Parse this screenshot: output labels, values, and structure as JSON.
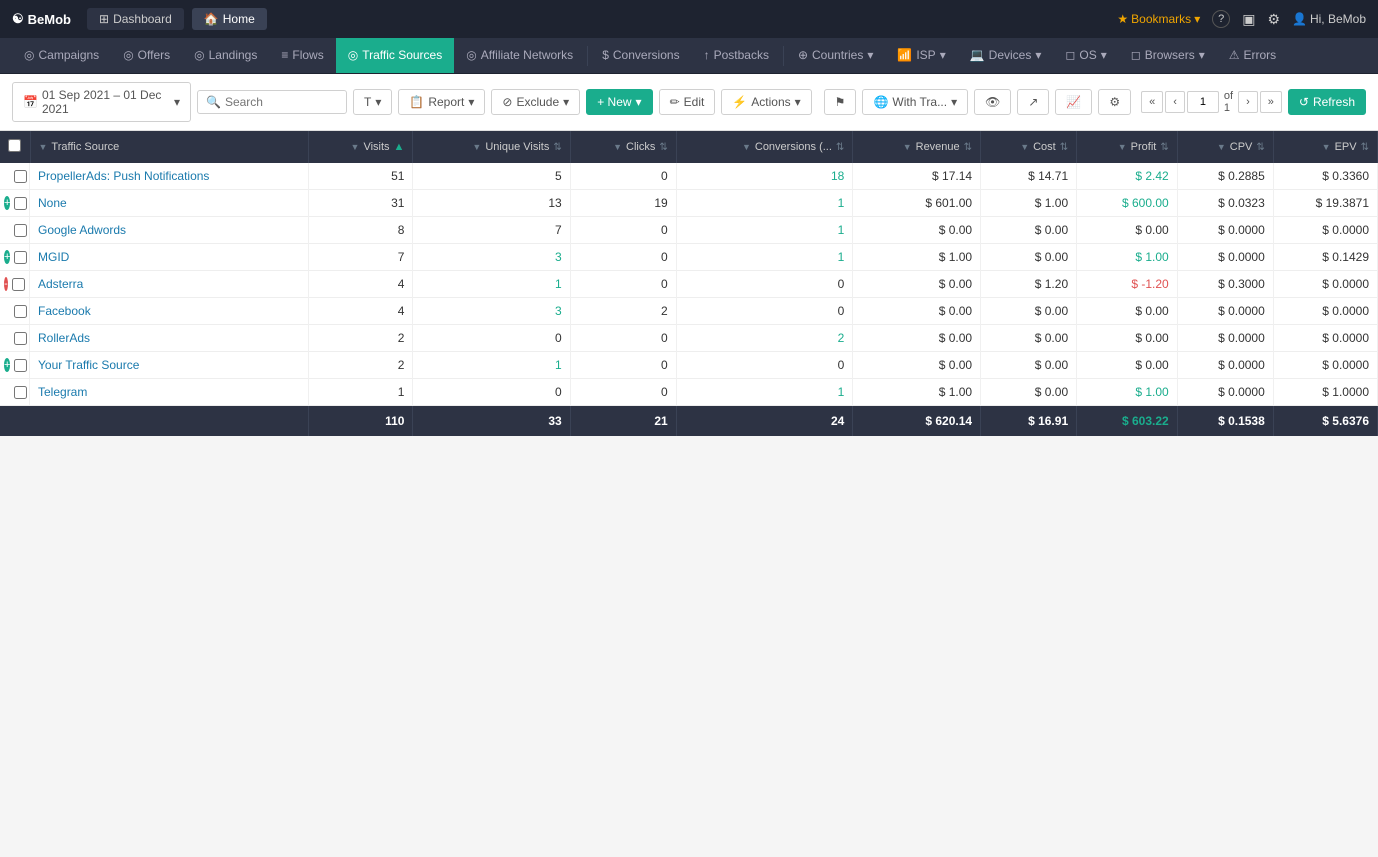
{
  "topNav": {
    "logo": "BeMob",
    "tabs": [
      {
        "id": "dashboard",
        "label": "Dashboard",
        "icon": "⊞",
        "active": false
      },
      {
        "id": "home",
        "label": "Home",
        "icon": "🏠",
        "active": true
      }
    ],
    "right": {
      "bookmarks": "Bookmarks",
      "help": "?",
      "notifications": "🔔",
      "settings": "⚙",
      "user": "Hi, BeMob"
    }
  },
  "secNav": {
    "items": [
      {
        "id": "campaigns",
        "label": "Campaigns",
        "icon": "◎"
      },
      {
        "id": "offers",
        "label": "Offers",
        "icon": "◎"
      },
      {
        "id": "landings",
        "label": "Landings",
        "icon": "◎"
      },
      {
        "id": "flows",
        "label": "Flows",
        "icon": "≡"
      },
      {
        "id": "traffic-sources",
        "label": "Traffic Sources",
        "icon": "◎",
        "active": true
      },
      {
        "id": "affiliate-networks",
        "label": "Affiliate Networks",
        "icon": "◎"
      },
      {
        "id": "conversions",
        "label": "Conversions",
        "icon": "$"
      },
      {
        "id": "postbacks",
        "label": "Postbacks",
        "icon": "↑"
      },
      {
        "id": "countries",
        "label": "Countries",
        "icon": "⊕",
        "hasDropdown": true
      },
      {
        "id": "isp",
        "label": "ISP",
        "icon": "📶",
        "hasDropdown": true
      },
      {
        "id": "devices",
        "label": "Devices",
        "icon": "💻",
        "hasDropdown": true
      },
      {
        "id": "os",
        "label": "OS",
        "icon": "◻",
        "hasDropdown": true
      },
      {
        "id": "browsers",
        "label": "Browsers",
        "icon": "◻",
        "hasDropdown": true
      },
      {
        "id": "errors",
        "label": "Errors",
        "icon": "⚠"
      }
    ]
  },
  "toolbar": {
    "dateRange": "01 Sep 2021 – 01 Dec 2021",
    "searchPlaceholder": "Search",
    "tBtn": "T",
    "reportLabel": "Report",
    "excludeLabel": "Exclude",
    "newLabel": "+ New",
    "editLabel": "Edit",
    "actionsLabel": "Actions",
    "withTraLabel": "With Tra...",
    "refreshLabel": "Refresh",
    "pageNum": "1",
    "pageTotal": "of 1"
  },
  "table": {
    "columns": [
      {
        "id": "traffic-source",
        "label": "Traffic Source",
        "sortable": true
      },
      {
        "id": "visits",
        "label": "Visits",
        "sortable": true,
        "sorted": "asc"
      },
      {
        "id": "unique-visits",
        "label": "Unique Visits",
        "sortable": true
      },
      {
        "id": "clicks",
        "label": "Clicks",
        "sortable": true
      },
      {
        "id": "conversions",
        "label": "Conversions (...",
        "sortable": true
      },
      {
        "id": "revenue",
        "label": "Revenue",
        "sortable": true
      },
      {
        "id": "cost",
        "label": "Cost",
        "sortable": true
      },
      {
        "id": "profit",
        "label": "Profit",
        "sortable": true
      },
      {
        "id": "cpv",
        "label": "CPV",
        "sortable": true
      },
      {
        "id": "epv",
        "label": "EPV",
        "sortable": true
      }
    ],
    "rows": [
      {
        "name": "PropellerAds: Push Notifications",
        "visits": 51,
        "uniqueVisits": 5,
        "clicks": 0,
        "conversions": 18,
        "revenue": "$ 17.14",
        "cost": "$ 14.71",
        "profit": "$ 2.42",
        "profitClass": "profit-pos",
        "cpv": "$ 0.2885",
        "epv": "$ 0.3360",
        "indicator": "none"
      },
      {
        "name": "None",
        "visits": 31,
        "uniqueVisits": 13,
        "clicks": 19,
        "conversions": 1,
        "revenue": "$ 601.00",
        "cost": "$ 1.00",
        "profit": "$ 600.00",
        "profitClass": "profit-pos",
        "cpv": "$ 0.0323",
        "epv": "$ 19.3871",
        "indicator": "green"
      },
      {
        "name": "Google Adwords",
        "visits": 8,
        "uniqueVisits": 7,
        "clicks": 0,
        "conversions": 1,
        "revenue": "$ 0.00",
        "cost": "$ 0.00",
        "profit": "$ 0.00",
        "profitClass": "",
        "cpv": "$ 0.0000",
        "epv": "$ 0.0000",
        "indicator": "none"
      },
      {
        "name": "MGID",
        "visits": 7,
        "uniqueVisits": 3,
        "clicks": 0,
        "conversions": 1,
        "revenue": "$ 1.00",
        "cost": "$ 0.00",
        "profit": "$ 1.00",
        "profitClass": "profit-pos",
        "cpv": "$ 0.0000",
        "epv": "$ 0.1429",
        "indicator": "green"
      },
      {
        "name": "Adsterra",
        "visits": 4,
        "uniqueVisits": 1,
        "clicks": 0,
        "conversions": 0,
        "revenue": "$ 0.00",
        "cost": "$ 1.20",
        "profit": "$ -1.20",
        "profitClass": "profit-neg",
        "cpv": "$ 0.3000",
        "epv": "$ 0.0000",
        "indicator": "red"
      },
      {
        "name": "Facebook",
        "visits": 4,
        "uniqueVisits": 3,
        "clicks": 2,
        "conversions": 0,
        "revenue": "$ 0.00",
        "cost": "$ 0.00",
        "profit": "$ 0.00",
        "profitClass": "",
        "cpv": "$ 0.0000",
        "epv": "$ 0.0000",
        "indicator": "none"
      },
      {
        "name": "RollerAds",
        "visits": 2,
        "uniqueVisits": 0,
        "clicks": 0,
        "conversions": 2,
        "revenue": "$ 0.00",
        "cost": "$ 0.00",
        "profit": "$ 0.00",
        "profitClass": "",
        "cpv": "$ 0.0000",
        "epv": "$ 0.0000",
        "indicator": "none"
      },
      {
        "name": "Your Traffic Source",
        "visits": 2,
        "uniqueVisits": 1,
        "clicks": 0,
        "conversions": 0,
        "revenue": "$ 0.00",
        "cost": "$ 0.00",
        "profit": "$ 0.00",
        "profitClass": "",
        "cpv": "$ 0.0000",
        "epv": "$ 0.0000",
        "indicator": "green"
      },
      {
        "name": "Telegram",
        "visits": 1,
        "uniqueVisits": 0,
        "clicks": 0,
        "conversions": 1,
        "revenue": "$ 1.00",
        "cost": "$ 0.00",
        "profit": "$ 1.00",
        "profitClass": "profit-pos",
        "cpv": "$ 0.0000",
        "epv": "$ 1.0000",
        "indicator": "none"
      }
    ],
    "totals": {
      "visits": "110",
      "uniqueVisits": "33",
      "clicks": "21",
      "conversions": "24",
      "revenue": "$ 620.14",
      "cost": "$ 16.91",
      "profit": "$ 603.22",
      "cpv": "$ 0.1538",
      "epv": "$ 5.6376"
    }
  }
}
